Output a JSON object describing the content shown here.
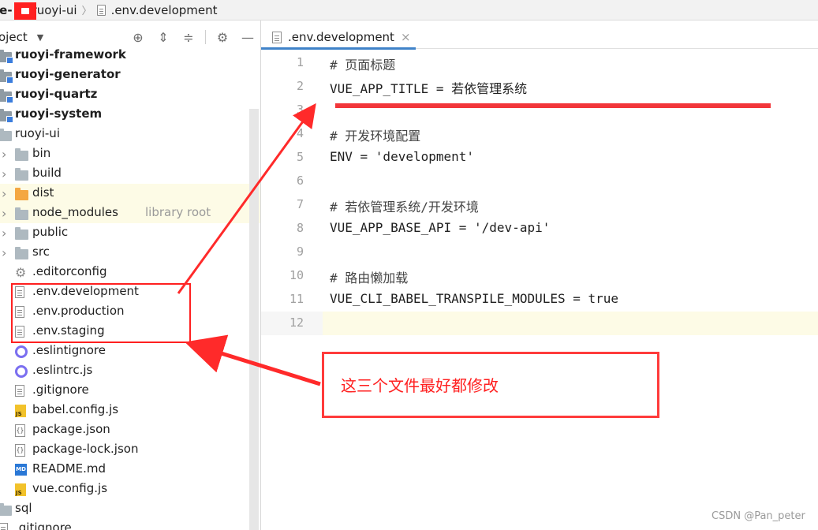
{
  "breadcrumb": {
    "items": [
      "ie-",
      "ruoyi-ui",
      ".env.development"
    ]
  },
  "project_panel": {
    "title": "oject"
  },
  "tree": [
    {
      "label": "ruoyi-framework",
      "bold": true,
      "type": "folder-mod",
      "caret": false,
      "indent": 0
    },
    {
      "label": "ruoyi-generator",
      "bold": true,
      "type": "folder-mod",
      "caret": false,
      "indent": 0
    },
    {
      "label": "ruoyi-quartz",
      "bold": true,
      "type": "folder-mod",
      "caret": false,
      "indent": 0
    },
    {
      "label": "ruoyi-system",
      "bold": true,
      "type": "folder-mod",
      "caret": false,
      "indent": 0
    },
    {
      "label": "ruoyi-ui",
      "bold": false,
      "type": "folder",
      "caret": false,
      "indent": 0
    },
    {
      "label": "bin",
      "bold": false,
      "type": "folder",
      "caret": true,
      "indent": 1
    },
    {
      "label": "build",
      "bold": false,
      "type": "folder",
      "caret": true,
      "indent": 1
    },
    {
      "label": "dist",
      "bold": false,
      "type": "folder-orange",
      "caret": true,
      "indent": 1,
      "highlight": true
    },
    {
      "label": "node_modules",
      "hint": "library root",
      "bold": false,
      "type": "folder",
      "caret": true,
      "indent": 1,
      "highlight": true
    },
    {
      "label": "public",
      "bold": false,
      "type": "folder",
      "caret": true,
      "indent": 1
    },
    {
      "label": "src",
      "bold": false,
      "type": "folder",
      "caret": true,
      "indent": 1
    },
    {
      "label": ".editorconfig",
      "bold": false,
      "type": "gear",
      "caret": false,
      "indent": 1
    },
    {
      "label": ".env.development",
      "bold": false,
      "type": "file",
      "caret": false,
      "indent": 1
    },
    {
      "label": ".env.production",
      "bold": false,
      "type": "file",
      "caret": false,
      "indent": 1
    },
    {
      "label": ".env.staging",
      "bold": false,
      "type": "file",
      "caret": false,
      "indent": 1
    },
    {
      "label": ".eslintignore",
      "bold": false,
      "type": "eslint",
      "caret": false,
      "indent": 1
    },
    {
      "label": ".eslintrc.js",
      "bold": false,
      "type": "eslint",
      "caret": false,
      "indent": 1
    },
    {
      "label": ".gitignore",
      "bold": false,
      "type": "file",
      "caret": false,
      "indent": 1
    },
    {
      "label": "babel.config.js",
      "bold": false,
      "type": "js",
      "caret": false,
      "indent": 1
    },
    {
      "label": "package.json",
      "bold": false,
      "type": "json",
      "caret": false,
      "indent": 1
    },
    {
      "label": "package-lock.json",
      "bold": false,
      "type": "json",
      "caret": false,
      "indent": 1
    },
    {
      "label": "README.md",
      "bold": false,
      "type": "md",
      "caret": false,
      "indent": 1
    },
    {
      "label": "vue.config.js",
      "bold": false,
      "type": "js",
      "caret": false,
      "indent": 1
    },
    {
      "label": "sql",
      "bold": false,
      "type": "folder",
      "caret": false,
      "indent": 0
    },
    {
      "label": ".gitignore",
      "bold": false,
      "type": "file",
      "caret": false,
      "indent": 0
    }
  ],
  "editor": {
    "tab_label": ".env.development",
    "tab_close": "×",
    "lines": [
      "# 页面标题",
      "VUE_APP_TITLE = 若依管理系统",
      "",
      "# 开发环境配置",
      "ENV = 'development'",
      "",
      "# 若依管理系统/开发环境",
      "VUE_APP_BASE_API = '/dev-api'",
      "",
      "# 路由懒加载",
      "VUE_CLI_BABEL_TRANSPILE_MODULES = true",
      ""
    ]
  },
  "annotation": {
    "note": "这三个文件最好都修改"
  },
  "watermark": "CSDN @Pan_peter",
  "colors": {
    "annotation_red": "#ff2020",
    "tab_accent": "#4083c9",
    "highlight_row": "#fdfbe6"
  },
  "icons": [
    "file-icon",
    "crosshair-icon",
    "expand-all-icon",
    "collapse-all-icon",
    "gear-icon",
    "minimize-icon",
    "folder-icon",
    "eslint-icon",
    "js-file-icon",
    "json-file-icon",
    "markdown-file-icon"
  ]
}
